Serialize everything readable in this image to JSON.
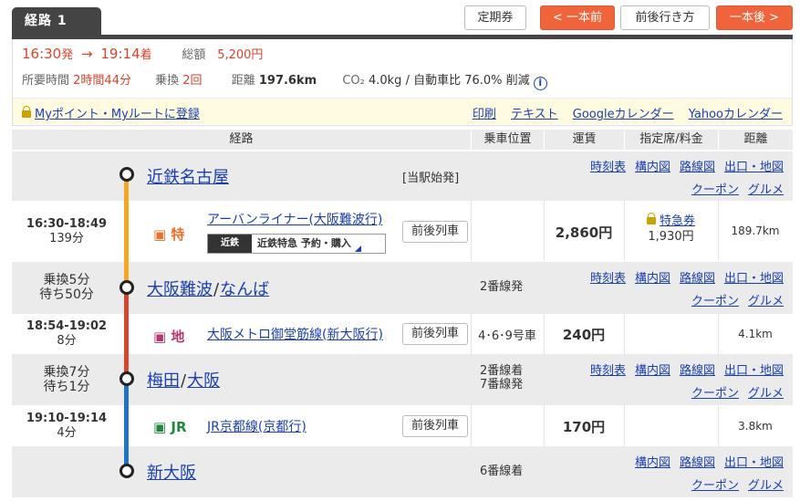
{
  "tab": {
    "label": "経路 1"
  },
  "buttons": {
    "teiki": "定期券",
    "prev": "< 一本前",
    "around": "前後行き方",
    "next": "一本後 >"
  },
  "summary": {
    "depart": "16:30",
    "depart_suffix": "発",
    "arrow": "→",
    "arrive": "19:14",
    "arrive_suffix": "着",
    "total_label": "総額",
    "total_value": "5,200円",
    "duration_label": "所要時間",
    "duration_value": "2時間44分",
    "transfer_label": "乗換",
    "transfer_value": "2回",
    "distance_label": "距離",
    "distance_value": "197.6km",
    "co2_label": "CO₂",
    "co2_value": "4.0kg / 自動車比 76.0% 削減",
    "info_icon": "i"
  },
  "register": {
    "label": "Myポイント・Myルートに登録"
  },
  "exports": [
    "印刷",
    "テキスト",
    "Googleカレンダー",
    "Yahooカレンダー"
  ],
  "table_headers": {
    "route": "経路",
    "position": "乗車位置",
    "fare": "運賃",
    "reserved": "指定席/料金",
    "distance": "距離"
  },
  "station_links": {
    "timetable": "時刻表",
    "map_in": "構内図",
    "route_map": "路線図",
    "exit": "出口・地図",
    "coupon": "クーポン",
    "gourmet": "グルメ"
  },
  "stations": [
    {
      "name": "近鉄名古屋",
      "note": "[当駅始発]"
    },
    {
      "name_a": "大阪難波",
      "sep": "/",
      "name_b": "なんば",
      "transfer": "乗換5分",
      "wait": "待ち50分",
      "platform": "2番線発"
    },
    {
      "name_a": "梅田",
      "sep": "/",
      "name_b": "大阪",
      "transfer": "乗換7分",
      "wait": "待ち1分",
      "platform_a": "2番線着",
      "platform_b": "7番線発"
    },
    {
      "name": "新大阪",
      "platform": "6番線着"
    }
  ],
  "sections": [
    {
      "time": "16:30-18:49",
      "duration": "139分",
      "icon": "特",
      "line": "アーバンライナー(大阪難波行)",
      "button": "前後列車",
      "fare": "2,860円",
      "express_label": "特急券",
      "express_fare": "1,930円",
      "distance": "189.7km",
      "banner_logo": "近鉄",
      "banner_text": "近鉄特急 予約・購入"
    },
    {
      "time": "18:54-19:02",
      "duration": "8分",
      "icon": "地",
      "line": "大阪メトロ御堂筋線(新大阪行)",
      "button": "前後列車",
      "position": "4･6･9号車",
      "fare": "240円",
      "distance": "4.1km"
    },
    {
      "time": "19:10-19:14",
      "duration": "4分",
      "icon": "JR",
      "line": "JR京都線(京都行)",
      "button": "前後列車",
      "fare": "170円",
      "distance": "3.8km"
    }
  ],
  "colors": {
    "accent": "#f0643c",
    "kintetsu_line": "#f5a623",
    "metro_line": "#d6452c",
    "jr_line": "#1f72c4",
    "link": "#1a3fb0"
  }
}
